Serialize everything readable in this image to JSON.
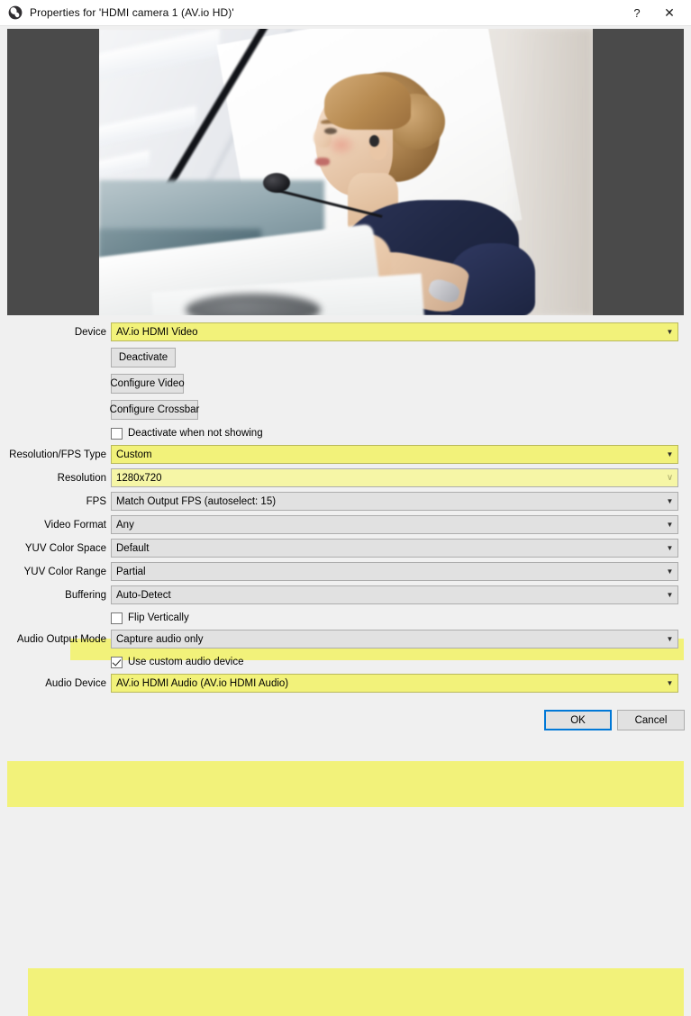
{
  "window": {
    "title": "Properties for 'HDMI camera 1 (AV.io HD)'",
    "icon": "obs-logo-icon",
    "help_label": "?",
    "close_label": "✕"
  },
  "preview": {
    "description": "Live video preview: blurred conference room, woman speaking at a podium with microphone",
    "letterbox_color": "#4a4a4a"
  },
  "form": {
    "device": {
      "label": "Device",
      "value": "AV.io HDMI Video",
      "highlighted": true
    },
    "buttons": {
      "deactivate": "Deactivate",
      "configure_video": "Configure Video",
      "configure_crossbar": "Configure Crossbar"
    },
    "deactivate_when_not_showing": {
      "label": "Deactivate when not showing",
      "checked": false
    },
    "resolution_fps_type": {
      "label": "Resolution/FPS Type",
      "value": "Custom",
      "highlighted": true
    },
    "resolution": {
      "label": "Resolution",
      "value": "1280x720",
      "highlighted": true
    },
    "fps": {
      "label": "FPS",
      "value": "Match Output FPS (autoselect: 15)"
    },
    "video_format": {
      "label": "Video Format",
      "value": "Any"
    },
    "yuv_color_space": {
      "label": "YUV Color Space",
      "value": "Default"
    },
    "yuv_color_range": {
      "label": "YUV Color Range",
      "value": "Partial"
    },
    "buffering": {
      "label": "Buffering",
      "value": "Auto-Detect"
    },
    "flip_vertically": {
      "label": "Flip Vertically",
      "checked": false
    },
    "audio_output_mode": {
      "label": "Audio Output Mode",
      "value": "Capture audio only"
    },
    "use_custom_audio_device": {
      "label": "Use custom audio device",
      "checked": true
    },
    "audio_device": {
      "label": "Audio Device",
      "value": "AV.io HDMI Audio (AV.io HDMI Audio)",
      "highlighted": true
    }
  },
  "footer": {
    "ok_label": "OK",
    "cancel_label": "Cancel"
  },
  "colors": {
    "highlight": "#f2f27a",
    "dialog_bg": "#f0f0f0",
    "field_bg": "#e1e1e1",
    "focus_blue": "#0078d7"
  },
  "icons": {
    "dropdown": "▼",
    "dropdown_light": "∨"
  }
}
